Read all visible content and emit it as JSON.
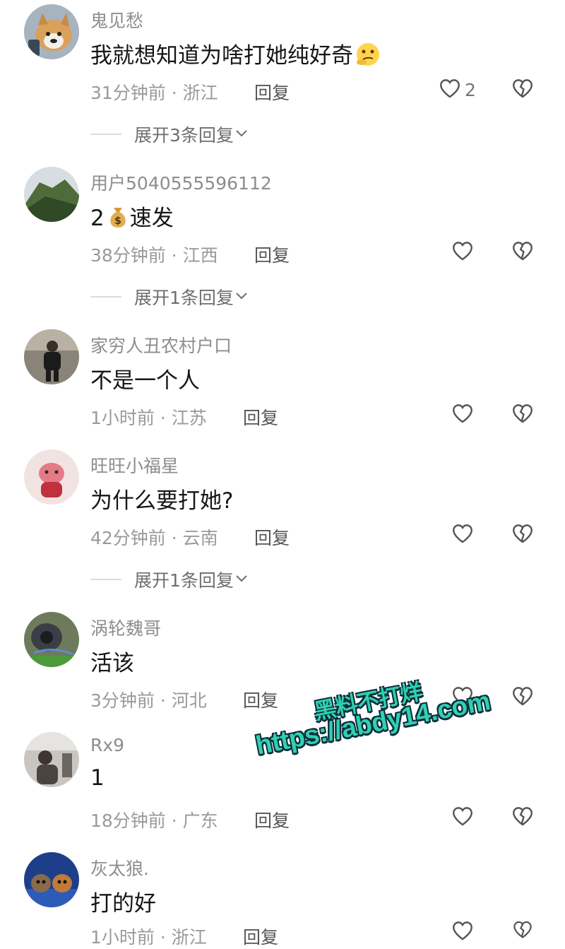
{
  "comments": [
    {
      "username": "鬼见愁",
      "content": "我就想知道为啥打她纯好奇",
      "emoji": "thinking-face",
      "time": "31分钟前",
      "location": "浙江",
      "reply_label": "回复",
      "like_count": "2",
      "expand_label": "展开3条回复"
    },
    {
      "username": "用户5040555596112",
      "content_prefix": "2",
      "emoji": "money-bag",
      "content": "速发",
      "time": "38分钟前",
      "location": "江西",
      "reply_label": "回复",
      "like_count": "",
      "expand_label": "展开1条回复"
    },
    {
      "username": "家穷人丑农村户口",
      "content": "不是一个人",
      "time": "1小时前",
      "location": "江苏",
      "reply_label": "回复",
      "like_count": ""
    },
    {
      "username": "旺旺小福星",
      "content": "为什么要打她?",
      "time": "42分钟前",
      "location": "云南",
      "reply_label": "回复",
      "like_count": "",
      "expand_label": "展开1条回复"
    },
    {
      "username": "涡轮魏哥",
      "content": "活该",
      "time": "3分钟前",
      "location": "河北",
      "reply_label": "回复",
      "like_count": ""
    },
    {
      "username": "Rx9",
      "content": "1",
      "time": "18分钟前",
      "location": "广东",
      "reply_label": "回复",
      "like_count": ""
    },
    {
      "username": "灰太狼.",
      "content": "打的好",
      "time": "1小时前",
      "location": "浙江",
      "reply_label": "回复",
      "like_count": ""
    }
  ],
  "separator": "·",
  "watermark": {
    "line1": "黑料不打烊",
    "line2": "https://abdy14.com"
  },
  "icons": {
    "like": "heart-outline-icon",
    "dislike": "broken-heart-icon",
    "expand": "chevron-down-icon"
  },
  "colors": {
    "text": "#161616",
    "muted": "#8d8d8d",
    "watermark": "#2fd1b0"
  }
}
